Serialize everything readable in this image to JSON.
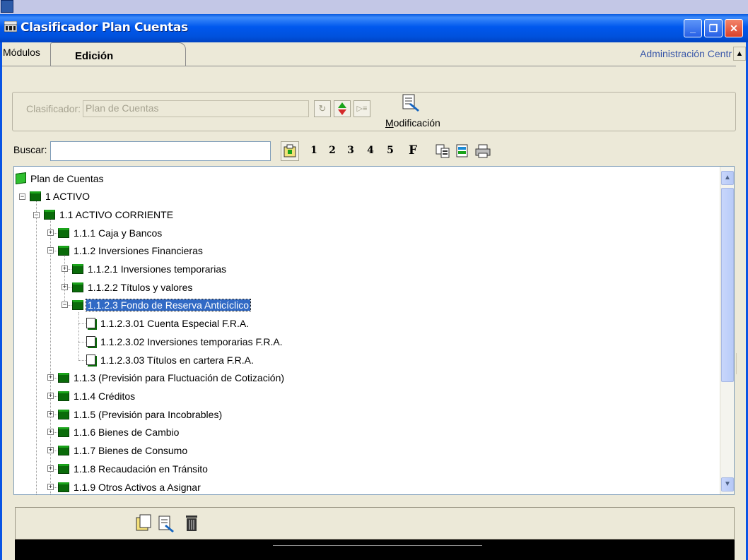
{
  "window": {
    "title": "Clasificador Plan Cuentas",
    "buttons": {
      "minimize": "_",
      "maximize": "❐",
      "close": "✕"
    }
  },
  "tabs": {
    "modules_label": "Módulos",
    "edition_label": "Edición",
    "admin_link": "Administración Centr"
  },
  "classifier": {
    "label": "Clasificador:",
    "value": "Plan de Cuentas",
    "modify_label_u": "M",
    "modify_label_rest": "odificación"
  },
  "search": {
    "label": "Buscar:",
    "value": "",
    "level_buttons": [
      "1",
      "2",
      "3",
      "4",
      "5"
    ],
    "f_button": "F"
  },
  "tree": {
    "root": "Plan de Cuentas",
    "nodes": [
      "1 ACTIVO",
      "1.1 ACTIVO CORRIENTE",
      "1.1.1 Caja y Bancos",
      "1.1.2 Inversiones Financieras",
      "1.1.2.1 Inversiones temporarias",
      "1.1.2.2 Títulos y valores",
      "1.1.2.3 Fondo de Reserva Anticíclico",
      "1.1.2.3.01 Cuenta Especial F.R.A.",
      "1.1.2.3.02 Inversiones temporarias F.R.A.",
      "1.1.2.3.03 Títulos en cartera F.R.A.",
      "1.1.3 (Previsión para Fluctuación de Cotización)",
      "1.1.4 Créditos",
      "1.1.5 (Previsión para Incobrables)",
      "1.1.6 Bienes de Cambio",
      "1.1.7 Bienes de Consumo",
      "1.1.8 Recaudación en Tránsito",
      "1.1.9 Otros Activos a Asignar"
    ],
    "selected": "1.1.2.3 Fondo de Reserva Anticíclico"
  },
  "icons": [
    "window-app-icon",
    "copy-icon",
    "refresh-icon",
    "print-icon",
    "new-folder-icon",
    "edit-icon",
    "trash-icon"
  ]
}
